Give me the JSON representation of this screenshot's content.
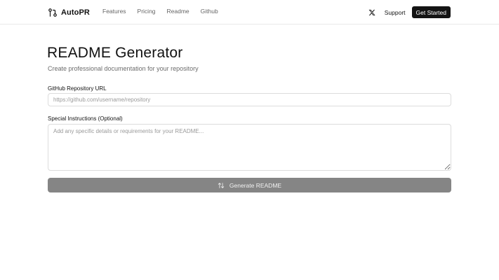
{
  "header": {
    "brand": {
      "name": "AutoPR",
      "icon": "git-pull-request-icon"
    },
    "nav": [
      {
        "label": "Features"
      },
      {
        "label": "Pricing"
      },
      {
        "label": "Readme"
      },
      {
        "label": "Github"
      }
    ],
    "social_icon": "x-logo-icon",
    "support_label": "Support",
    "cta_label": "Get Started"
  },
  "main": {
    "title": "README Generator",
    "subtitle": "Create professional documentation for your repository",
    "repo_url": {
      "label": "GitHub Repository URL",
      "value": "",
      "placeholder": "https://github.com/username/repository"
    },
    "instructions": {
      "label": "Special Instructions (Optional)",
      "value": "",
      "placeholder": "Add any specific details or requirements for your README..."
    },
    "generate_button": {
      "label": "Generate README",
      "icon": "swap-arrows-icon",
      "color": "#858585"
    }
  },
  "colors": {
    "primary_dark": "#141414",
    "muted_text": "#6b6b6b",
    "border": "#dcdcdc"
  }
}
